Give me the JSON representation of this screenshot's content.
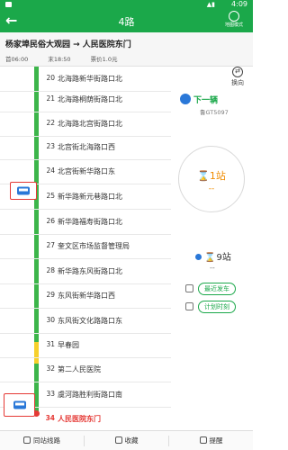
{
  "status_bar": {
    "time": "4:09"
  },
  "header": {
    "back_symbol": "←",
    "title": "4路",
    "map_mode_label": "地图模式"
  },
  "route_info": {
    "direction": "杨家埠民俗大观园 → 人民医院东门",
    "first_bus": "首06:00",
    "last_bus": "末18:50",
    "fare": "票价1.0元"
  },
  "stops": [
    {
      "number": "20",
      "name": "北海路新华街路口北"
    },
    {
      "number": "21",
      "name": "北海路桐荫街路口北"
    },
    {
      "number": "22",
      "name": "北海路北宫街路口北"
    },
    {
      "number": "23",
      "name": "北宫街北海路口西"
    },
    {
      "number": "24",
      "name": "北宫街新华路口东"
    },
    {
      "number": "25",
      "name": "新华路新元巷路口北"
    },
    {
      "number": "26",
      "name": "新华路福寿街路口北"
    },
    {
      "number": "27",
      "name": "奎文区市场监督管理局"
    },
    {
      "number": "28",
      "name": "新华路东风街路口北"
    },
    {
      "number": "29",
      "name": "东风街新华路口西"
    },
    {
      "number": "30",
      "name": "东风街文化路路口东"
    },
    {
      "number": "31",
      "name": "早春园"
    },
    {
      "number": "32",
      "name": "第二人民医院"
    },
    {
      "number": "33",
      "name": "虞河路胜利街路口南"
    },
    {
      "number": "34",
      "name": "人民医院东门"
    }
  ],
  "panel": {
    "swap_label": "换向",
    "next_bus_label": "下一辆",
    "plate": "鲁GT5097",
    "stations_away": "1站",
    "hourglass": "⌛",
    "dash": "--",
    "second_bus_stations": "9站",
    "second_dash": "--",
    "latest_departure_label": "最近发车",
    "schedule_label": "计划时刻"
  },
  "bottom_bar": {
    "same_stop_routes": "同站线路",
    "favorite": "收藏",
    "reminder": "提醒"
  },
  "colors": {
    "brand_green": "#1ba84a",
    "route_line_green": "#3cb54a",
    "slow_segment_yellow": "#f6d02b",
    "terminal_red": "#e53935",
    "bus_blue": "#2a78d8",
    "countdown_orange": "#f08c00"
  }
}
